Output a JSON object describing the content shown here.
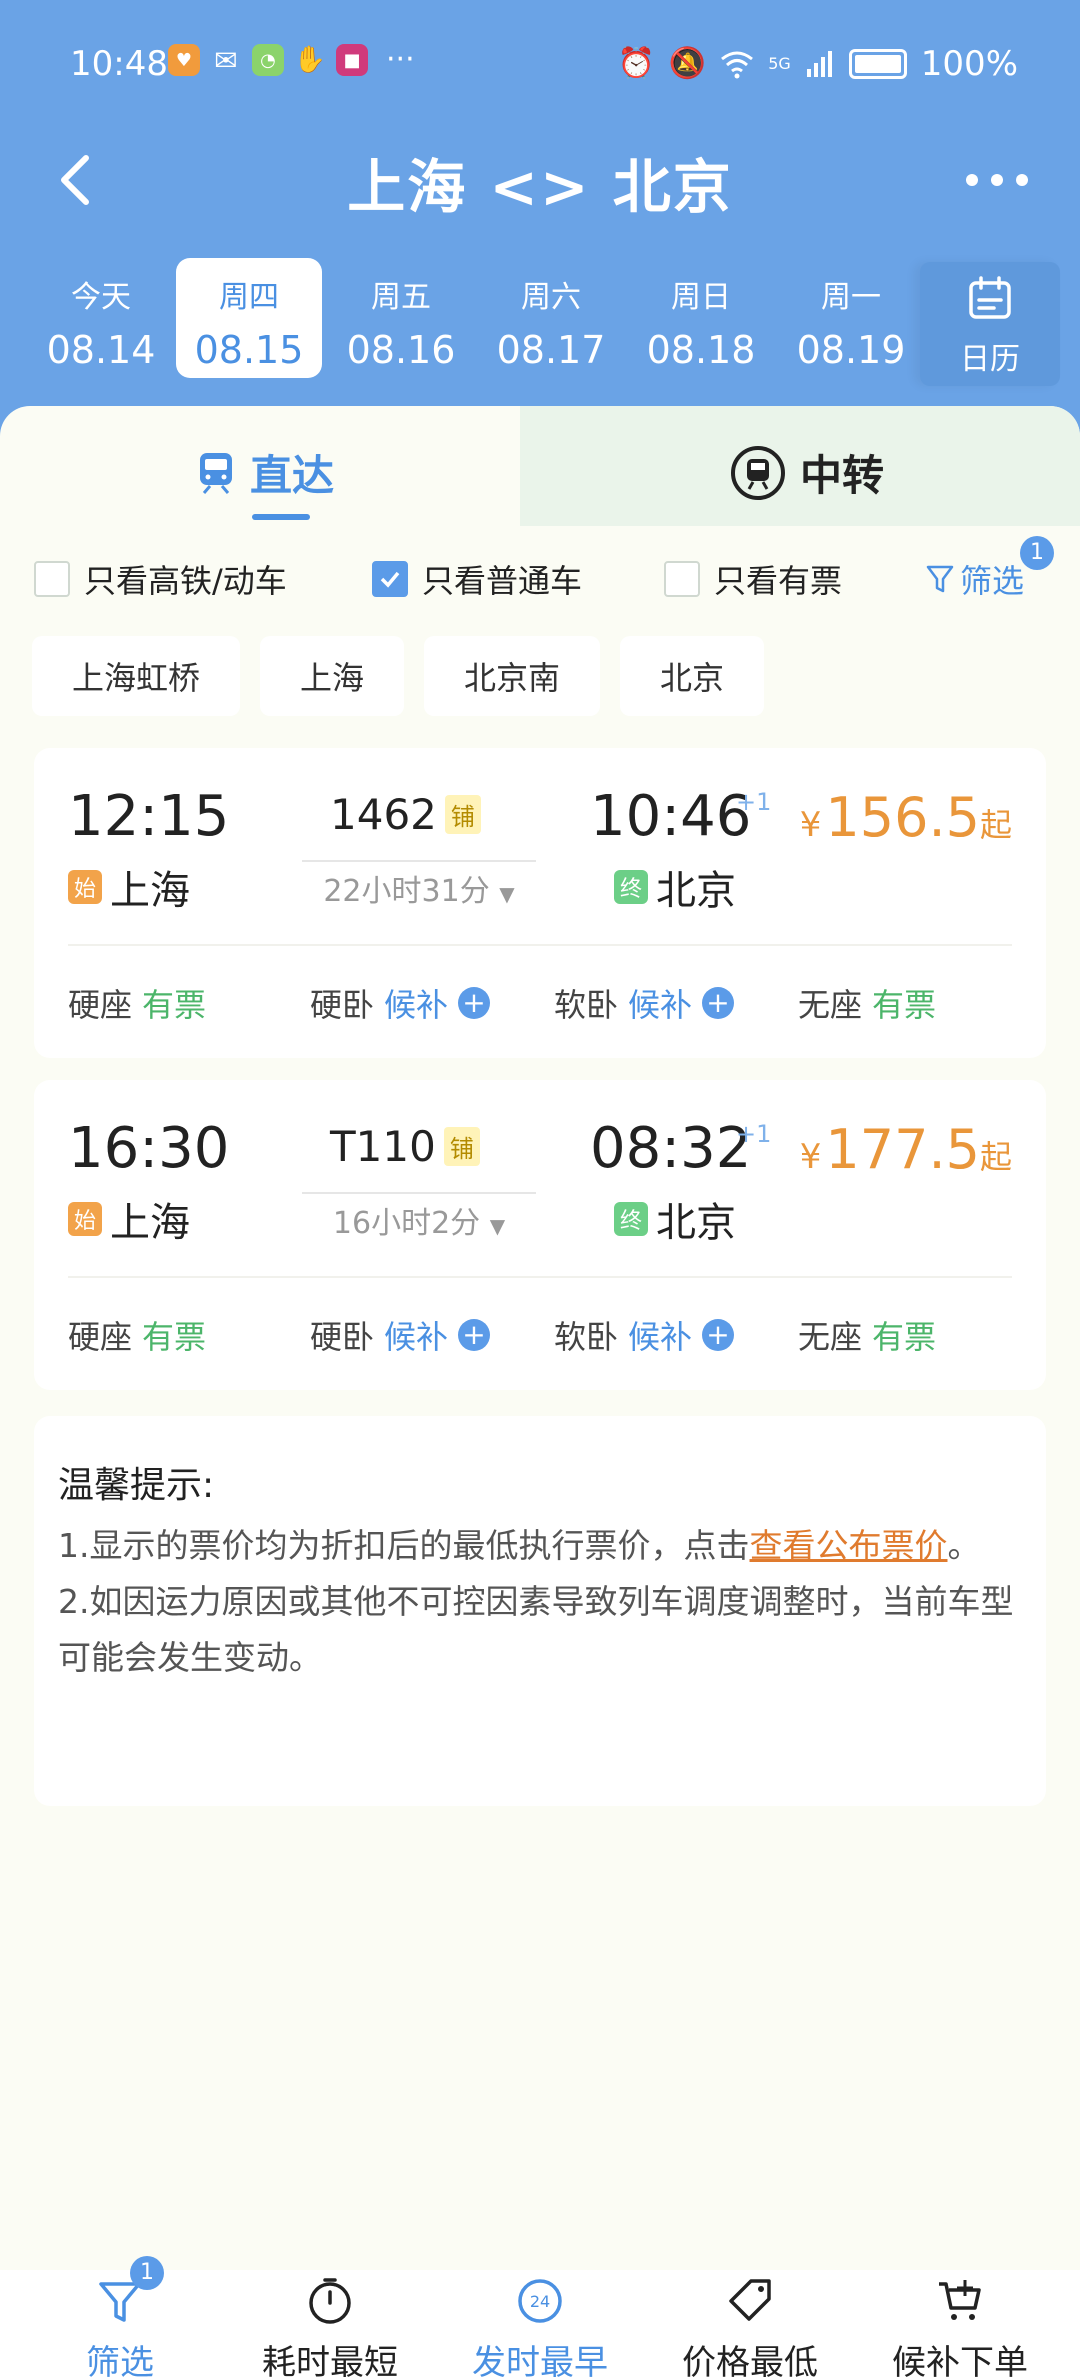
{
  "status_bar": {
    "time": "10:48",
    "battery": "100%",
    "network": "5G"
  },
  "nav": {
    "title": "上海 <> 北京"
  },
  "dates": [
    {
      "weekday": "今天",
      "date": "08.14",
      "active": false
    },
    {
      "weekday": "周四",
      "date": "08.15",
      "active": true
    },
    {
      "weekday": "周五",
      "date": "08.16",
      "active": false
    },
    {
      "weekday": "周六",
      "date": "08.17",
      "active": false
    },
    {
      "weekday": "周日",
      "date": "08.18",
      "active": false
    },
    {
      "weekday": "周一",
      "date": "08.19",
      "active": false
    }
  ],
  "calendar_label": "日历",
  "mode_tabs": {
    "direct": "直达",
    "transfer": "中转"
  },
  "filters": {
    "high_speed": {
      "label": "只看高铁/动车",
      "checked": false
    },
    "normal": {
      "label": "只看普通车",
      "checked": true
    },
    "available": {
      "label": "只看有票",
      "checked": false
    },
    "filter_label": "筛选",
    "filter_count": "1"
  },
  "stations": [
    "上海虹桥",
    "上海",
    "北京南",
    "北京"
  ],
  "trains": [
    {
      "dep_time": "12:15",
      "arr_time": "10:46",
      "plus_day": "+1",
      "train_no": "1462",
      "berth_tag": "铺",
      "duration": "22小时31分",
      "dep_station": "上海",
      "arr_station": "北京",
      "start_tag": "始",
      "end_tag": "终",
      "price_currency": "¥",
      "price": "156.5",
      "price_suffix": "起",
      "seats": [
        {
          "type": "硬座",
          "status": "有票",
          "kind": "avail"
        },
        {
          "type": "硬卧",
          "status": "候补",
          "kind": "wait"
        },
        {
          "type": "软卧",
          "status": "候补",
          "kind": "wait"
        },
        {
          "type": "无座",
          "status": "有票",
          "kind": "avail"
        }
      ]
    },
    {
      "dep_time": "16:30",
      "arr_time": "08:32",
      "plus_day": "+1",
      "train_no": "T110",
      "berth_tag": "铺",
      "duration": "16小时2分",
      "dep_station": "上海",
      "arr_station": "北京",
      "start_tag": "始",
      "end_tag": "终",
      "price_currency": "¥",
      "price": "177.5",
      "price_suffix": "起",
      "seats": [
        {
          "type": "硬座",
          "status": "有票",
          "kind": "avail"
        },
        {
          "type": "硬卧",
          "status": "候补",
          "kind": "wait"
        },
        {
          "type": "软卧",
          "status": "候补",
          "kind": "wait"
        },
        {
          "type": "无座",
          "status": "有票",
          "kind": "avail"
        }
      ]
    }
  ],
  "tips": {
    "title": "温馨提示:",
    "line1_prefix": "1.显示的票价均为折扣后的最低执行票价，点击",
    "line1_link": "查看公布票价",
    "line1_suffix": "。",
    "line2": "2.如因运力原因或其他不可控因素导致列车调度调整时，当前车型可能会发生变动。"
  },
  "bottom_bar": {
    "filter": "筛选",
    "filter_badge": "1",
    "shortest": "耗时最短",
    "earliest": "发时最早",
    "earliest_icon_text": "24",
    "cheapest": "价格最低",
    "waitlist": "候补下单"
  },
  "colors": {
    "header_blue": "#6aa3e6",
    "accent_blue": "#4a90e2",
    "price_orange": "#e9963a",
    "available_green": "#4cb56a"
  }
}
